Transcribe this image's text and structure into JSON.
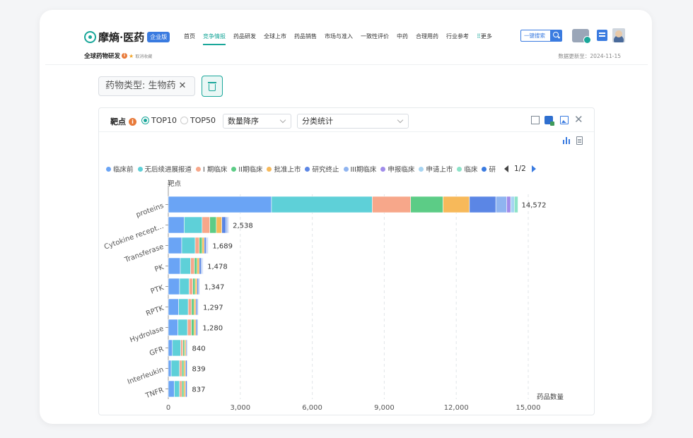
{
  "header": {
    "brand_name": "摩熵·医药",
    "brand_badge": "企业版",
    "nav": [
      {
        "label": "首页",
        "active": false
      },
      {
        "label": "竞争情报",
        "active": true
      },
      {
        "label": "药品研发",
        "active": false
      },
      {
        "label": "全球上市",
        "active": false
      },
      {
        "label": "药品销售",
        "active": false
      },
      {
        "label": "市场与准入",
        "active": false
      },
      {
        "label": "一致性评价",
        "active": false
      },
      {
        "label": "中药",
        "active": false
      },
      {
        "label": "合理用药",
        "active": false
      },
      {
        "label": "行业参考",
        "active": false
      }
    ],
    "more_label": "更多",
    "search_label": "一键搜索"
  },
  "subheader": {
    "page_title": "全球药物研发",
    "unfavorite_label": "取消收藏",
    "updated_label": "数据更新至：2024-11-15"
  },
  "filter": {
    "chip_label": "药物类型: 生物药"
  },
  "panel": {
    "title": "靶点",
    "radio_top10": "TOP10",
    "radio_top50": "TOP50",
    "sort_select": "数量降序",
    "group_select": "分类统计",
    "page_indicator": "1/2"
  },
  "colors": {
    "accent": "#1aa79a",
    "primary_blue": "#3a7be0"
  },
  "chart_data": {
    "type": "bar",
    "orientation": "horizontal",
    "stacked": true,
    "title": "",
    "ylabel": "靶点",
    "xlabel": "药品数量",
    "xlim": [
      0,
      15000
    ],
    "xticks": [
      "0",
      "3,000",
      "6,000",
      "9,000",
      "12,000",
      "15,000"
    ],
    "grid": true,
    "categories": [
      "proteins",
      "Cytokine recept...",
      "Transferase",
      "PK",
      "PTK",
      "RPTK",
      "Hydrolase",
      "GFR",
      "Interleukin",
      "TNFR"
    ],
    "total_labels": [
      "14,572",
      "2,538",
      "1,689",
      "1,478",
      "1,347",
      "1,297",
      "1,280",
      "840",
      "839",
      "837"
    ],
    "series": [
      {
        "name": "临床前",
        "color": "#6aa4f5",
        "values": [
          4300,
          660,
          560,
          500,
          470,
          430,
          400,
          170,
          120,
          250
        ]
      },
      {
        "name": "无后续进展报道",
        "color": "#5ed0d8",
        "values": [
          4200,
          750,
          560,
          430,
          400,
          400,
          400,
          350,
          350,
          220
        ]
      },
      {
        "name": "I 期临床",
        "color": "#f7a78a",
        "values": [
          1600,
          320,
          170,
          160,
          150,
          140,
          160,
          90,
          100,
          100
        ]
      },
      {
        "name": "II期临床",
        "color": "#5ccc86",
        "values": [
          1350,
          270,
          120,
          110,
          100,
          100,
          110,
          70,
          80,
          80
        ]
      },
      {
        "name": "批准上市",
        "color": "#f7b95a",
        "values": [
          1100,
          230,
          90,
          90,
          80,
          80,
          80,
          60,
          70,
          70
        ]
      },
      {
        "name": "研究终止",
        "color": "#5b86e5",
        "values": [
          1100,
          170,
          70,
          80,
          60,
          60,
          60,
          45,
          55,
          55
        ]
      },
      {
        "name": "III期临床",
        "color": "#8fb4f0",
        "values": [
          450,
          70,
          50,
          50,
          40,
          40,
          35,
          25,
          30,
          30
        ]
      },
      {
        "name": "申报临床",
        "color": "#a08cea",
        "values": [
          170,
          30,
          30,
          25,
          20,
          20,
          15,
          12,
          14,
          14
        ]
      },
      {
        "name": "申请上市",
        "color": "#a6d4f2",
        "values": [
          150,
          20,
          20,
          20,
          15,
          15,
          10,
          10,
          10,
          10
        ]
      },
      {
        "name": "临床",
        "color": "#8ce3c8",
        "values": [
          152,
          18,
          19,
          13,
          12,
          12,
          10,
          8,
          10,
          8
        ]
      }
    ],
    "legend_overflow_label": "研"
  }
}
